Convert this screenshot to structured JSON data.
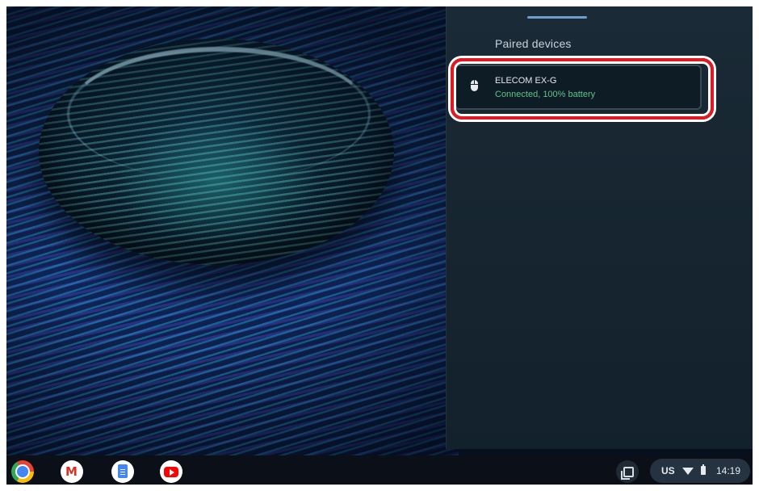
{
  "panel": {
    "heading": "Paired devices",
    "devices": [
      {
        "name": "ELECOM EX-G",
        "status": "Connected, 100% battery",
        "icon": "mouse-icon"
      }
    ]
  },
  "shelf": {
    "apps": [
      {
        "name": "Chrome",
        "icon": "chrome-icon"
      },
      {
        "name": "Gmail",
        "icon": "gmail-icon",
        "glyph": "M"
      },
      {
        "name": "Docs",
        "icon": "docs-icon"
      },
      {
        "name": "YouTube",
        "icon": "youtube-icon"
      }
    ],
    "status": {
      "ime": "US",
      "time": "14:19"
    }
  },
  "colors": {
    "status_connected": "#5ec28a",
    "highlight_annotation": "#e01a22",
    "accent": "#6f9fcc"
  }
}
